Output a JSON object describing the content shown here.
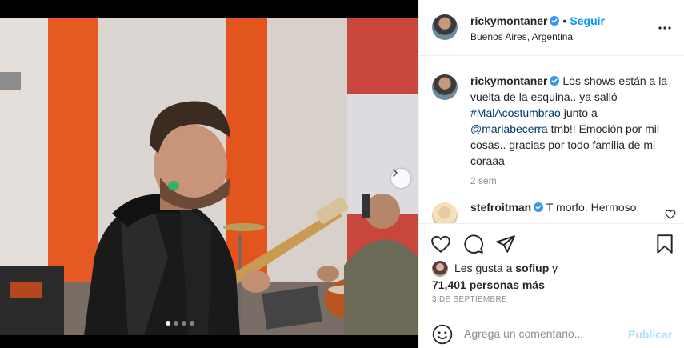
{
  "post": {
    "username": "ricky​montaner",
    "follow_label": "Seguir",
    "separator": "•",
    "location": "Buenos Aires, Argentina"
  },
  "caption": {
    "username": "ricky​montaner",
    "text_1": " Los shows están a la vuelta de la esquina.. ya salió ",
    "hashtag": "#MalAcostumbrao",
    "text_2": " junto a ",
    "mention": "@mariabecerra",
    "text_3": " tmb!! Emoción por mil cosas.. gracias por todo familia de mi coraaa",
    "time": "2 sem"
  },
  "comment": {
    "username": "stefroitman",
    "text": " T morfo. Hermoso."
  },
  "likes": {
    "prefix": "Les gusta a ",
    "user": "sofiup",
    "suffix": " y",
    "count": "71,401 personas más"
  },
  "date": "3 de septiembre",
  "add_comment": {
    "placeholder": "Agrega un comentario...",
    "publish_label": "Publicar"
  },
  "carousel": {
    "slides": 4,
    "active_index": 0
  },
  "colors": {
    "accent": "#0095f6",
    "text": "#262626",
    "muted": "#8e8e8e",
    "link": "#00376b",
    "publish_disabled": "#b2dffc",
    "verified": "#3897f0"
  },
  "icons": [
    "verified-badge-icon",
    "more-options-icon",
    "chevron-right-icon",
    "heart-icon",
    "comment-icon",
    "share-icon",
    "bookmark-icon",
    "emoji-icon"
  ]
}
